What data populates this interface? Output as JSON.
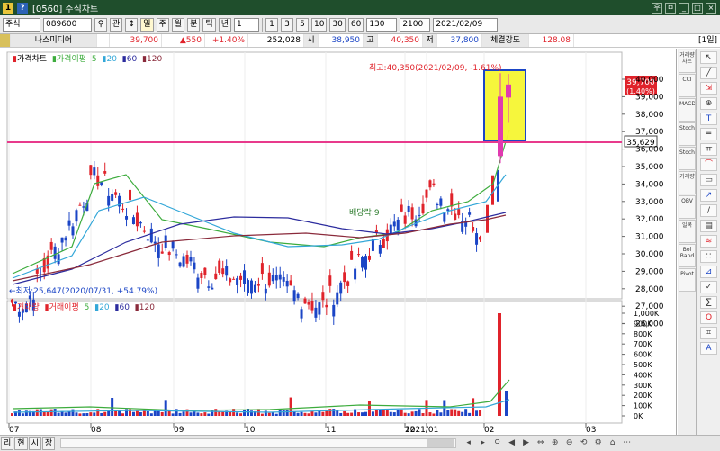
{
  "window": {
    "title": "[0560] 주식차트",
    "icon_left": "1",
    "icon_help": "?",
    "btn_min": "_",
    "btn_max": "□",
    "btn_close": "×",
    "btn_a": "우",
    "btn_b": "ㅁ"
  },
  "toolbar": {
    "market": "주식",
    "code": "089600",
    "chk": "관",
    "periods": [
      "주",
      "월",
      "분",
      "틱",
      "년"
    ],
    "interval": "1",
    "minutes": [
      "1",
      "3",
      "5",
      "10",
      "30",
      "60"
    ],
    "count": "130",
    "total": "2100",
    "date": "2021/02/09"
  },
  "info": {
    "stock_name": "나스미디어",
    "mark": "i",
    "price": "39,700",
    "change": "▲550",
    "change_pct": "+1.40%",
    "volume": "252,028",
    "low_label": "시",
    "open": "38,950",
    "high_label": "고",
    "high": "40,350",
    "low2_label": "저",
    "low": "37,800",
    "strength_label": "체결강도",
    "strength": "128.08",
    "period_button": "[1일]"
  },
  "price_panel": {
    "legend_price": "가격차트",
    "legend_ma": "가격이평",
    "ma_periods": [
      "5",
      "20",
      "60",
      "120"
    ],
    "high_note": "최고:40,350(2021/02/09, -1.61%)",
    "low_note": "←최저:25,647(2020/07/31, +54.79%)",
    "dividend_note": "배당락:9",
    "current_price": "39,700",
    "current_pct": "(1.40%)",
    "hline_value": "35,629",
    "axis": [
      "40,000",
      "39,000",
      "38,000",
      "37,000",
      "36,000",
      "35,000",
      "34,000",
      "33,000",
      "32,000",
      "31,000",
      "30,000",
      "29,000",
      "28,000",
      "27,000",
      "26,000"
    ]
  },
  "volume_panel": {
    "legend_vol": "거래량",
    "legend_ma": "거래이평",
    "ma_periods": [
      "5",
      "20",
      "60",
      "120"
    ],
    "axis": [
      "1,000K",
      "900K",
      "800K",
      "700K",
      "600K",
      "500K",
      "400K",
      "300K",
      "200K",
      "100K",
      "0K"
    ]
  },
  "xaxis": [
    "07",
    "08",
    "09",
    "10",
    "11",
    "12",
    "2021/01",
    "02",
    "03"
  ],
  "rightbar": [
    "거래량차트",
    "CCI",
    "MACD",
    "Stoch",
    "Stoch",
    "거래량",
    "OBV",
    "일목",
    "Bol Band",
    "Pivot"
  ],
  "tools": [
    "↖",
    "╱",
    "⇲",
    "⊕",
    "T",
    "═",
    "ㅠ",
    "⌒",
    "▭",
    "↗",
    "/",
    "▤",
    "≋",
    "∷",
    "⊿",
    "✓",
    "∑",
    "Q",
    "⌗",
    "A"
  ],
  "bottom": {
    "tabs": [
      "리",
      "현",
      "시",
      "장"
    ],
    "icons": [
      "◂",
      "▸",
      "ㅇ",
      "◀",
      "▶",
      "⇔",
      "⊕",
      "⊖",
      "⟲",
      "⚙",
      "⌂",
      "⋯"
    ]
  },
  "colors": {
    "up": "#e0232b",
    "down": "#1b45c6",
    "hline": "#e83a8c",
    "highlight": "#f5f532",
    "ma5": "#3dac3d",
    "ma20": "#33a7d8",
    "ma60": "#2c2c9e",
    "ma120": "#8a2a3b"
  }
}
